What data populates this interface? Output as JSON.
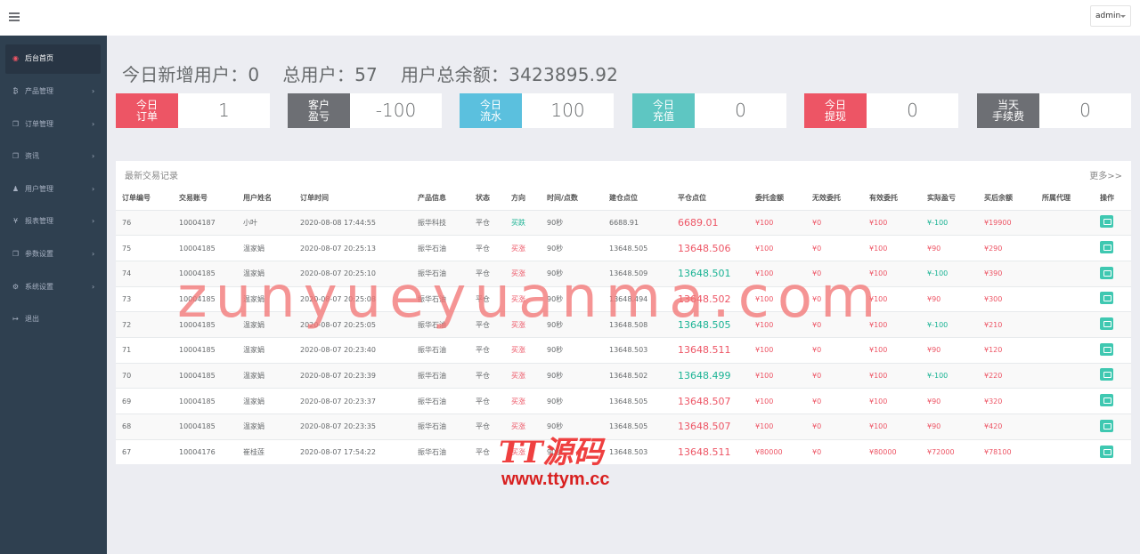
{
  "header": {
    "user": "admin"
  },
  "sidebar": {
    "items": [
      {
        "label": "后台首页",
        "icon": "dashboard-icon",
        "glyph": "◉",
        "active": true
      },
      {
        "label": "产品管理",
        "icon": "bitcoin-icon",
        "glyph": "₿"
      },
      {
        "label": "订单管理",
        "icon": "copy-icon",
        "glyph": "❐"
      },
      {
        "label": "资讯",
        "icon": "copy-icon",
        "glyph": "❐"
      },
      {
        "label": "用户管理",
        "icon": "user-icon",
        "glyph": "♟"
      },
      {
        "label": "报表管理",
        "icon": "yen-icon",
        "glyph": "¥"
      },
      {
        "label": "参数设置",
        "icon": "copy-icon",
        "glyph": "❐"
      },
      {
        "label": "系统设置",
        "icon": "gears-icon",
        "glyph": "⚙"
      },
      {
        "label": "退出",
        "icon": "sign-out-icon",
        "glyph": "↦"
      }
    ]
  },
  "summary": {
    "new_users": "今日新增用户：0",
    "total_users": "总用户：57",
    "total_balance": "用户总余额：3423895.92"
  },
  "stats": [
    {
      "line1": "今日",
      "line2": "订单",
      "value": "1",
      "color": "#ed5565"
    },
    {
      "line1": "客户",
      "line2": "盈亏",
      "value": "-100",
      "color": "#6d6f74"
    },
    {
      "line1": "今日",
      "line2": "流水",
      "value": "100",
      "color": "#5bc0de"
    },
    {
      "line1": "今日",
      "line2": "充值",
      "value": "0",
      "color": "#5ec6c2"
    },
    {
      "line1": "今日",
      "line2": "提现",
      "value": "0",
      "color": "#ed5565"
    },
    {
      "line1": "当天",
      "line2": "手续费",
      "value": "0",
      "color": "#6d6f74"
    }
  ],
  "trades": {
    "title": "最新交易记录",
    "more": "更多>>",
    "columns": [
      "订单编号",
      "交易账号",
      "用户姓名",
      "订单时间",
      "产品信息",
      "状态",
      "方向",
      "时间/点数",
      "建仓点位",
      "平仓点位",
      "委托金额",
      "无效委托",
      "有效委托",
      "实际盈亏",
      "买后余额",
      "所属代理",
      "操作"
    ],
    "rows": [
      [
        "76",
        "10004187",
        "小叶",
        "2020-08-08 17:44:55",
        "振华科技",
        "平仓",
        "买跌",
        "90秒",
        "6688.91",
        "6689.01",
        "¥100",
        "¥0",
        "¥100",
        "¥-100",
        "¥19900",
        ""
      ],
      [
        "75",
        "10004185",
        "温家娟",
        "2020-08-07 20:25:13",
        "振华石油",
        "平仓",
        "买涨",
        "90秒",
        "13648.505",
        "13648.506",
        "¥100",
        "¥0",
        "¥100",
        "¥90",
        "¥290",
        ""
      ],
      [
        "74",
        "10004185",
        "温家娟",
        "2020-08-07 20:25:10",
        "振华石油",
        "平仓",
        "买涨",
        "90秒",
        "13648.509",
        "13648.501",
        "¥100",
        "¥0",
        "¥100",
        "¥-100",
        "¥390",
        ""
      ],
      [
        "73",
        "10004185",
        "温家娟",
        "2020-08-07 20:25:08",
        "振华石油",
        "平仓",
        "买涨",
        "90秒",
        "13648.494",
        "13648.502",
        "¥100",
        "¥0",
        "¥100",
        "¥90",
        "¥300",
        ""
      ],
      [
        "72",
        "10004185",
        "温家娟",
        "2020-08-07 20:25:05",
        "振华石油",
        "平仓",
        "买涨",
        "90秒",
        "13648.508",
        "13648.505",
        "¥100",
        "¥0",
        "¥100",
        "¥-100",
        "¥210",
        ""
      ],
      [
        "71",
        "10004185",
        "温家娟",
        "2020-08-07 20:23:40",
        "振华石油",
        "平仓",
        "买涨",
        "90秒",
        "13648.503",
        "13648.511",
        "¥100",
        "¥0",
        "¥100",
        "¥90",
        "¥120",
        ""
      ],
      [
        "70",
        "10004185",
        "温家娟",
        "2020-08-07 20:23:39",
        "振华石油",
        "平仓",
        "买涨",
        "90秒",
        "13648.502",
        "13648.499",
        "¥100",
        "¥0",
        "¥100",
        "¥-100",
        "¥220",
        ""
      ],
      [
        "69",
        "10004185",
        "温家娟",
        "2020-08-07 20:23:37",
        "振华石油",
        "平仓",
        "买涨",
        "90秒",
        "13648.505",
        "13648.507",
        "¥100",
        "¥0",
        "¥100",
        "¥90",
        "¥320",
        ""
      ],
      [
        "68",
        "10004185",
        "温家娟",
        "2020-08-07 20:23:35",
        "振华石油",
        "平仓",
        "买涨",
        "90秒",
        "13648.505",
        "13648.507",
        "¥100",
        "¥0",
        "¥100",
        "¥90",
        "¥420",
        ""
      ],
      [
        "67",
        "10004176",
        "崔桂莲",
        "2020-08-07 17:54:22",
        "振华石油",
        "平仓",
        "买涨",
        "90秒",
        "13648.503",
        "13648.511",
        "¥80000",
        "¥0",
        "¥80000",
        "¥72000",
        "¥78100",
        ""
      ]
    ],
    "close_colors": [
      "red",
      "red",
      "green",
      "red",
      "green",
      "red",
      "green",
      "red",
      "red",
      "red"
    ]
  },
  "watermarks": {
    "site": "zunyueyuanma.com",
    "logo": "TT源码",
    "url": "www.ttym.cc"
  }
}
